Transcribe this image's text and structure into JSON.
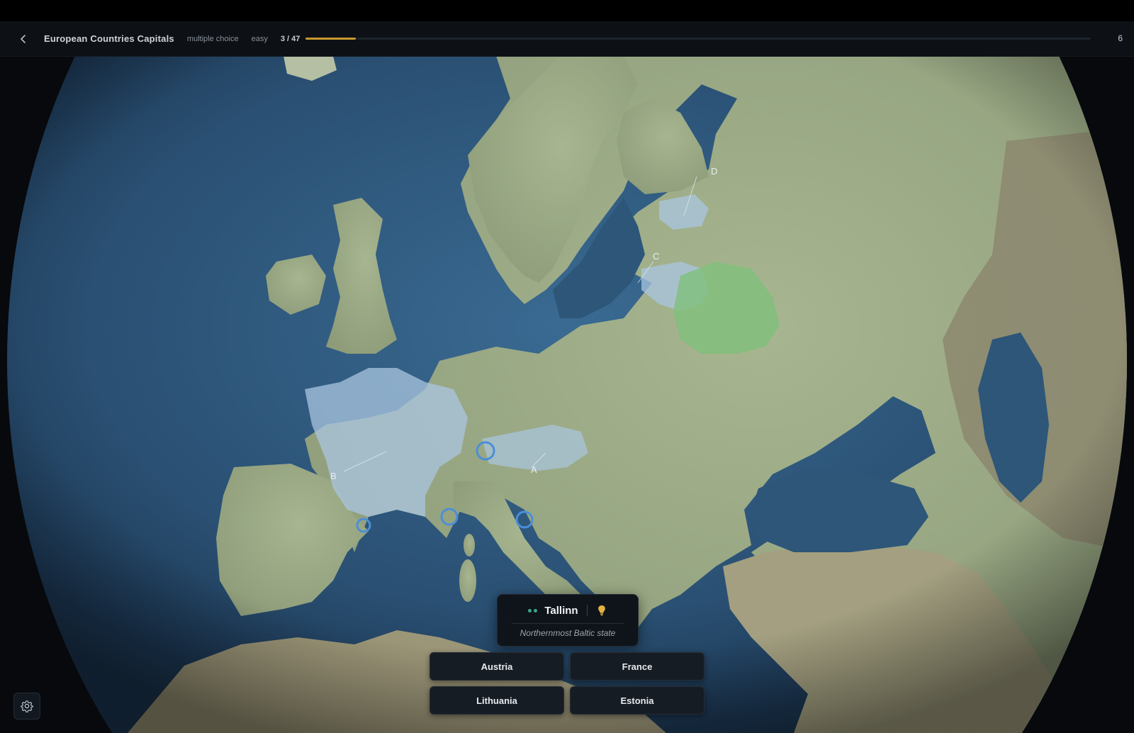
{
  "header": {
    "title": "European Countries Capitals",
    "mode": "multiple choice",
    "difficulty": "easy",
    "progress_label": "3 / 47",
    "progress": {
      "current": 3,
      "total": 47
    },
    "score": "6",
    "back_icon": "chevron-left-icon"
  },
  "map": {
    "labels": {
      "a": "A",
      "b": "B",
      "c": "C",
      "d": "D"
    },
    "colors": {
      "ocean": "#2c5478",
      "land": "#9fae8a",
      "highlight_candidate": "#a9c6e0",
      "highlight_belarus": "#7fbf7a",
      "marker": "#4a8fd8"
    }
  },
  "question": {
    "prompt": "Tallinn",
    "hint": "Northernmost Baltic state",
    "hint_icon": "lightbulb-icon"
  },
  "answers": [
    "Austria",
    "France",
    "Lithuania",
    "Estonia"
  ],
  "settings_icon": "gear-icon"
}
